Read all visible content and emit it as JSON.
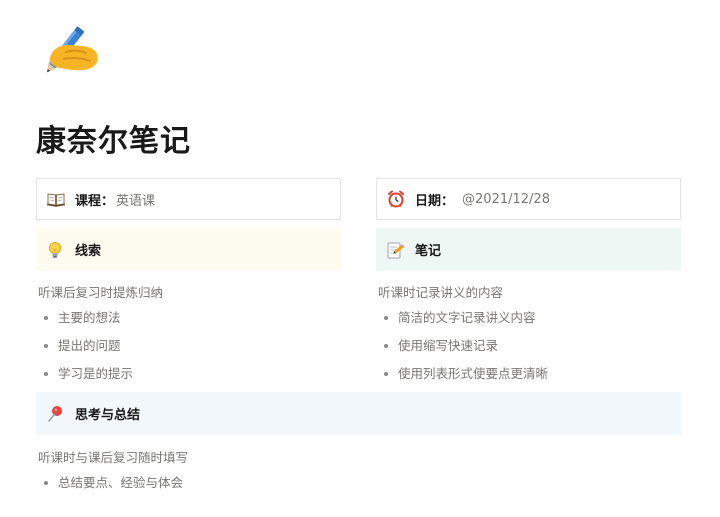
{
  "page": {
    "icon": "writing-hand-emoji",
    "title": "康奈尔笔记"
  },
  "properties": {
    "course": {
      "icon": "open-book-emoji",
      "label": "课程",
      "colon": "：",
      "value": "英语课"
    },
    "date": {
      "icon": "alarm-clock-emoji",
      "label": "日期",
      "colon": "：",
      "value": "@2021/12/28"
    }
  },
  "cues": {
    "icon": "light-bulb-emoji",
    "title": "线索",
    "description": "听课后复习时提炼归纳",
    "items": [
      "主要的想法",
      "提出的问题",
      "学习是的提示"
    ]
  },
  "notes": {
    "icon": "memo-emoji",
    "title": "笔记",
    "description": "听课时记录讲义的内容",
    "items": [
      "简洁的文字记录讲义内容",
      "使用缩写快速记录",
      "使用列表形式使要点更清晰"
    ]
  },
  "summary": {
    "icon": "pushpin-emoji",
    "title": "思考与总结",
    "description": "听课时与课后复习随时填写",
    "items": [
      "总结要点、经验与体会"
    ]
  },
  "colors": {
    "cue_bg": "#fefcf0",
    "note_bg": "#eef7f4",
    "summary_bg": "#f2f8fc"
  }
}
